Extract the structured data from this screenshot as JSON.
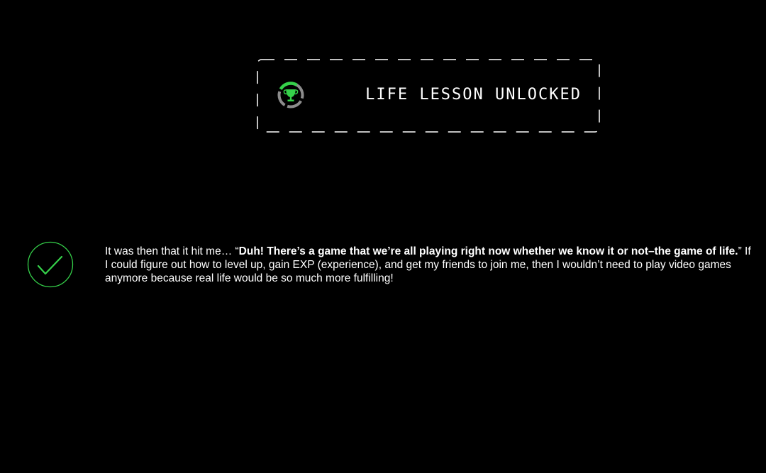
{
  "colors": {
    "background": "#000000",
    "accent_green": "#35d14a",
    "badge_grey": "#8c8c8c",
    "text": "#ffffff",
    "frame_dash": "#ffffff"
  },
  "banner": {
    "title": "LIFE LESSON UNLOCKED",
    "icon": "trophy-icon"
  },
  "lesson": {
    "icon": "checkmark-icon",
    "text_intro": "It was then that it hit me… “",
    "text_bold": "Duh! There’s a game that we’re all playing right now whether we know it or not–the game of life.",
    "text_rest": "” If I could figure out how to level up, gain EXP (experience), and get my friends to join me, then I wouldn’t need to play video games anymore because real life would be so much more fulfilling!"
  }
}
